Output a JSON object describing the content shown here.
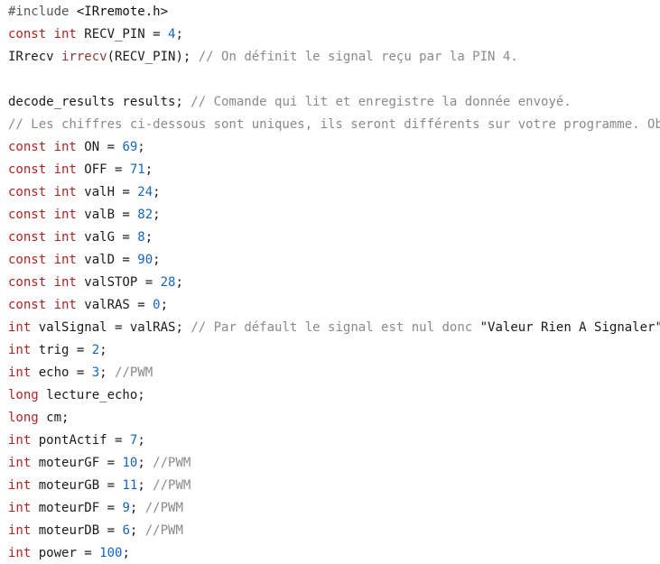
{
  "editor": {
    "lines": [
      [
        {
          "t": "pp",
          "v": "#include "
        },
        {
          "t": "inc",
          "v": "<IRremote.h>"
        }
      ],
      [
        {
          "t": "kw",
          "v": "const int"
        },
        {
          "t": "txt",
          "v": " RECV_PIN = "
        },
        {
          "t": "num",
          "v": "4"
        },
        {
          "t": "txt",
          "v": ";"
        }
      ],
      [
        {
          "t": "txt",
          "v": "IRrecv "
        },
        {
          "t": "func",
          "v": "irrecv"
        },
        {
          "t": "txt",
          "v": "(RECV_PIN); "
        },
        {
          "t": "cmt",
          "v": "// On définit le signal reçu par la PIN 4."
        }
      ],
      [],
      [
        {
          "t": "txt",
          "v": "decode_results results; "
        },
        {
          "t": "cmt",
          "v": "// Comande qui lit et enregistre la donnée envoyé."
        }
      ],
      [
        {
          "t": "cmt",
          "v": "// Les chiffres ci-dessous sont uniques, ils seront différents sur votre programme. Obte"
        }
      ],
      [
        {
          "t": "kw",
          "v": "const int"
        },
        {
          "t": "txt",
          "v": " ON = "
        },
        {
          "t": "num",
          "v": "69"
        },
        {
          "t": "txt",
          "v": ";"
        }
      ],
      [
        {
          "t": "kw",
          "v": "const int"
        },
        {
          "t": "txt",
          "v": " OFF = "
        },
        {
          "t": "num",
          "v": "71"
        },
        {
          "t": "txt",
          "v": ";"
        }
      ],
      [
        {
          "t": "kw",
          "v": "const int"
        },
        {
          "t": "txt",
          "v": " valH = "
        },
        {
          "t": "num",
          "v": "24"
        },
        {
          "t": "txt",
          "v": ";"
        }
      ],
      [
        {
          "t": "kw",
          "v": "const int"
        },
        {
          "t": "txt",
          "v": " valB = "
        },
        {
          "t": "num",
          "v": "82"
        },
        {
          "t": "txt",
          "v": ";"
        }
      ],
      [
        {
          "t": "kw",
          "v": "const int"
        },
        {
          "t": "txt",
          "v": " valG = "
        },
        {
          "t": "num",
          "v": "8"
        },
        {
          "t": "txt",
          "v": ";"
        }
      ],
      [
        {
          "t": "kw",
          "v": "const int"
        },
        {
          "t": "txt",
          "v": " valD = "
        },
        {
          "t": "num",
          "v": "90"
        },
        {
          "t": "txt",
          "v": ";"
        }
      ],
      [
        {
          "t": "kw",
          "v": "const int"
        },
        {
          "t": "txt",
          "v": " valSTOP = "
        },
        {
          "t": "num",
          "v": "28"
        },
        {
          "t": "txt",
          "v": ";"
        }
      ],
      [
        {
          "t": "kw",
          "v": "const int"
        },
        {
          "t": "txt",
          "v": " valRAS = "
        },
        {
          "t": "num",
          "v": "0"
        },
        {
          "t": "txt",
          "v": ";"
        }
      ],
      [
        {
          "t": "kw",
          "v": "int"
        },
        {
          "t": "txt",
          "v": " valSignal = valRAS; "
        },
        {
          "t": "cmt",
          "v": "// Par défault le signal est nul donc "
        },
        {
          "t": "str",
          "v": "\"Valeur Rien A Signaler\"."
        }
      ],
      [
        {
          "t": "kw",
          "v": "int"
        },
        {
          "t": "txt",
          "v": " trig = "
        },
        {
          "t": "num",
          "v": "2"
        },
        {
          "t": "txt",
          "v": ";"
        }
      ],
      [
        {
          "t": "kw",
          "v": "int"
        },
        {
          "t": "txt",
          "v": " echo = "
        },
        {
          "t": "num",
          "v": "3"
        },
        {
          "t": "txt",
          "v": "; "
        },
        {
          "t": "cmt",
          "v": "//PWM"
        }
      ],
      [
        {
          "t": "kw",
          "v": "long"
        },
        {
          "t": "txt",
          "v": " lecture_echo;"
        }
      ],
      [
        {
          "t": "kw",
          "v": "long"
        },
        {
          "t": "txt",
          "v": " cm;"
        }
      ],
      [
        {
          "t": "kw",
          "v": "int"
        },
        {
          "t": "txt",
          "v": " pontActif = "
        },
        {
          "t": "num",
          "v": "7"
        },
        {
          "t": "txt",
          "v": ";"
        }
      ],
      [
        {
          "t": "kw",
          "v": "int"
        },
        {
          "t": "txt",
          "v": " moteurGF = "
        },
        {
          "t": "num",
          "v": "10"
        },
        {
          "t": "txt",
          "v": "; "
        },
        {
          "t": "cmt",
          "v": "//PWM"
        }
      ],
      [
        {
          "t": "kw",
          "v": "int"
        },
        {
          "t": "txt",
          "v": " moteurGB = "
        },
        {
          "t": "num",
          "v": "11"
        },
        {
          "t": "txt",
          "v": "; "
        },
        {
          "t": "cmt",
          "v": "//PWM"
        }
      ],
      [
        {
          "t": "kw",
          "v": "int"
        },
        {
          "t": "txt",
          "v": " moteurDF = "
        },
        {
          "t": "num",
          "v": "9"
        },
        {
          "t": "txt",
          "v": "; "
        },
        {
          "t": "cmt",
          "v": "//PWM"
        }
      ],
      [
        {
          "t": "kw",
          "v": "int"
        },
        {
          "t": "txt",
          "v": " moteurDB = "
        },
        {
          "t": "num",
          "v": "6"
        },
        {
          "t": "txt",
          "v": "; "
        },
        {
          "t": "cmt",
          "v": "//PWM"
        }
      ],
      [
        {
          "t": "kw",
          "v": "int"
        },
        {
          "t": "txt",
          "v": " power = "
        },
        {
          "t": "num",
          "v": "100"
        },
        {
          "t": "txt",
          "v": ";"
        }
      ]
    ]
  }
}
